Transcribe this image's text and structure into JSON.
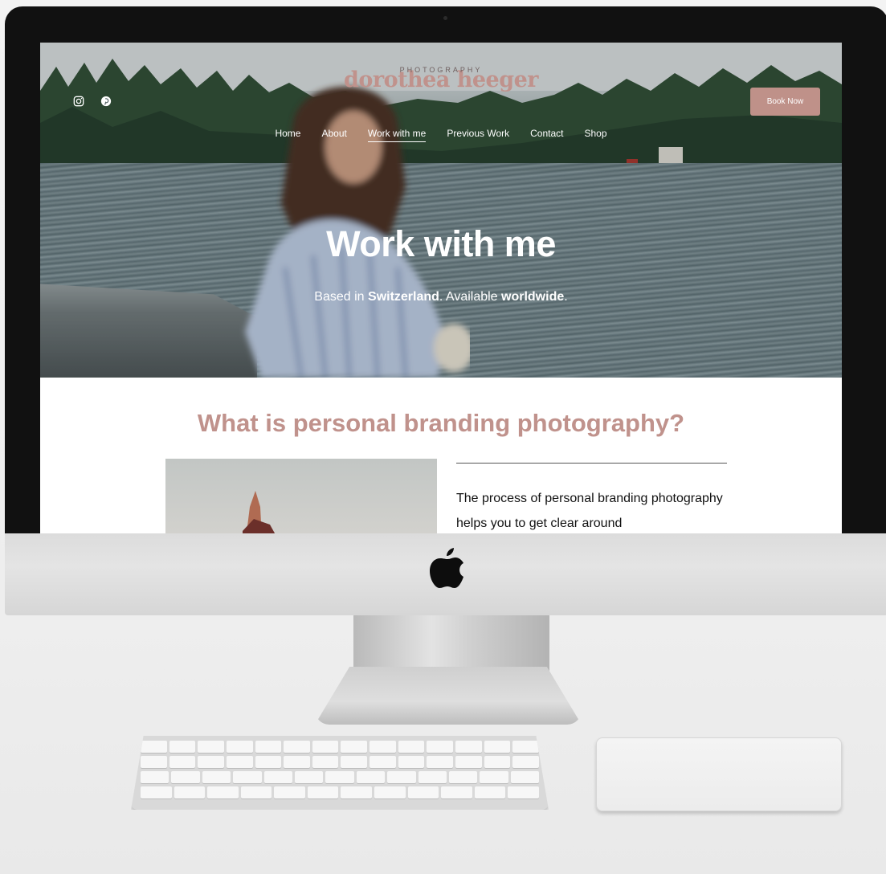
{
  "site": {
    "logo_name": "dorothea heeger",
    "logo_sub": "PHOTOGRAPHY",
    "social_icons": [
      "instagram-icon",
      "pinterest-icon"
    ],
    "nav": [
      {
        "label": "Home",
        "active": false
      },
      {
        "label": "About",
        "active": false
      },
      {
        "label": "Work with me",
        "active": true
      },
      {
        "label": "Previous Work",
        "active": false
      },
      {
        "label": "Contact",
        "active": false
      },
      {
        "label": "Shop",
        "active": false
      }
    ],
    "book_button": "Book Now"
  },
  "hero": {
    "title": "Work with me",
    "sub_prefix": "Based in ",
    "sub_bold_1": "Switzerland",
    "sub_middle": ". Available ",
    "sub_bold_2": "worldwide",
    "sub_suffix": "."
  },
  "content": {
    "section_title": "What is personal branding photography?",
    "body_text": "The process of personal branding photography helps you to get clear around"
  },
  "colors": {
    "accent": "#c0928c",
    "button": "#bf9189",
    "hero_text": "#ffffff"
  }
}
